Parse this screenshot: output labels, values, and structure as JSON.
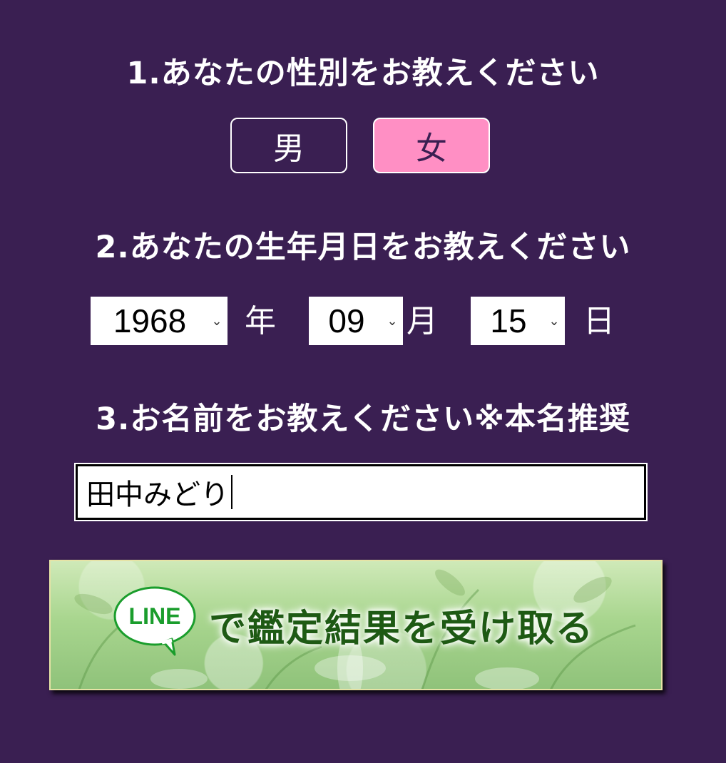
{
  "questions": {
    "q1": "1.あなたの性別をお教えください",
    "q2": "2.あなたの生年月日をお教えください",
    "q3": "3.お名前をお教えください※本名推奨"
  },
  "gender": {
    "male_label": "男",
    "female_label": "女",
    "selected": "女"
  },
  "birthdate": {
    "year": "1968",
    "year_unit": "年",
    "month": "09",
    "month_unit": "月",
    "day": "15",
    "day_unit": "日"
  },
  "name": {
    "value": "田中みどり"
  },
  "banner": {
    "logo_text": "LINE",
    "text": "で鑑定結果を受け取る"
  },
  "colors": {
    "background": "#3a1f52",
    "selected_gender": "#ff8fc4",
    "line_green": "#1a9d2c"
  }
}
